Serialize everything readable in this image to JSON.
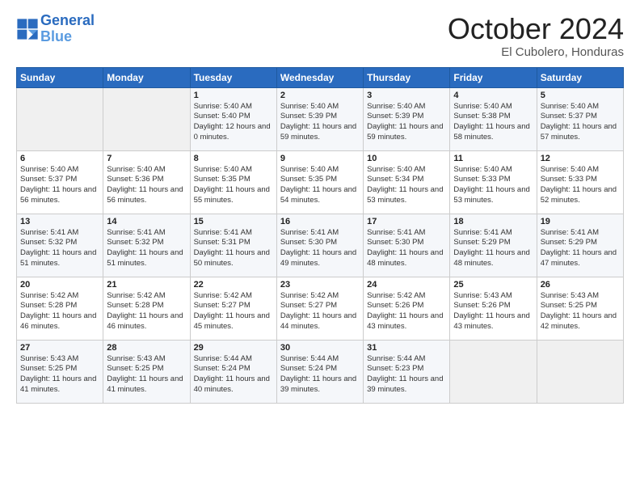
{
  "logo": {
    "line1": "General",
    "line2": "Blue"
  },
  "title": "October 2024",
  "location": "El Cubolero, Honduras",
  "days_header": [
    "Sunday",
    "Monday",
    "Tuesday",
    "Wednesday",
    "Thursday",
    "Friday",
    "Saturday"
  ],
  "weeks": [
    [
      {
        "day": "",
        "info": ""
      },
      {
        "day": "",
        "info": ""
      },
      {
        "day": "1",
        "sunrise": "5:40 AM",
        "sunset": "5:40 PM",
        "daylight": "12 hours and 0 minutes."
      },
      {
        "day": "2",
        "sunrise": "5:40 AM",
        "sunset": "5:39 PM",
        "daylight": "11 hours and 59 minutes."
      },
      {
        "day": "3",
        "sunrise": "5:40 AM",
        "sunset": "5:39 PM",
        "daylight": "11 hours and 59 minutes."
      },
      {
        "day": "4",
        "sunrise": "5:40 AM",
        "sunset": "5:38 PM",
        "daylight": "11 hours and 58 minutes."
      },
      {
        "day": "5",
        "sunrise": "5:40 AM",
        "sunset": "5:37 PM",
        "daylight": "11 hours and 57 minutes."
      }
    ],
    [
      {
        "day": "6",
        "sunrise": "5:40 AM",
        "sunset": "5:37 PM",
        "daylight": "11 hours and 56 minutes."
      },
      {
        "day": "7",
        "sunrise": "5:40 AM",
        "sunset": "5:36 PM",
        "daylight": "11 hours and 56 minutes."
      },
      {
        "day": "8",
        "sunrise": "5:40 AM",
        "sunset": "5:35 PM",
        "daylight": "11 hours and 55 minutes."
      },
      {
        "day": "9",
        "sunrise": "5:40 AM",
        "sunset": "5:35 PM",
        "daylight": "11 hours and 54 minutes."
      },
      {
        "day": "10",
        "sunrise": "5:40 AM",
        "sunset": "5:34 PM",
        "daylight": "11 hours and 53 minutes."
      },
      {
        "day": "11",
        "sunrise": "5:40 AM",
        "sunset": "5:33 PM",
        "daylight": "11 hours and 53 minutes."
      },
      {
        "day": "12",
        "sunrise": "5:40 AM",
        "sunset": "5:33 PM",
        "daylight": "11 hours and 52 minutes."
      }
    ],
    [
      {
        "day": "13",
        "sunrise": "5:41 AM",
        "sunset": "5:32 PM",
        "daylight": "11 hours and 51 minutes."
      },
      {
        "day": "14",
        "sunrise": "5:41 AM",
        "sunset": "5:32 PM",
        "daylight": "11 hours and 51 minutes."
      },
      {
        "day": "15",
        "sunrise": "5:41 AM",
        "sunset": "5:31 PM",
        "daylight": "11 hours and 50 minutes."
      },
      {
        "day": "16",
        "sunrise": "5:41 AM",
        "sunset": "5:30 PM",
        "daylight": "11 hours and 49 minutes."
      },
      {
        "day": "17",
        "sunrise": "5:41 AM",
        "sunset": "5:30 PM",
        "daylight": "11 hours and 48 minutes."
      },
      {
        "day": "18",
        "sunrise": "5:41 AM",
        "sunset": "5:29 PM",
        "daylight": "11 hours and 48 minutes."
      },
      {
        "day": "19",
        "sunrise": "5:41 AM",
        "sunset": "5:29 PM",
        "daylight": "11 hours and 47 minutes."
      }
    ],
    [
      {
        "day": "20",
        "sunrise": "5:42 AM",
        "sunset": "5:28 PM",
        "daylight": "11 hours and 46 minutes."
      },
      {
        "day": "21",
        "sunrise": "5:42 AM",
        "sunset": "5:28 PM",
        "daylight": "11 hours and 46 minutes."
      },
      {
        "day": "22",
        "sunrise": "5:42 AM",
        "sunset": "5:27 PM",
        "daylight": "11 hours and 45 minutes."
      },
      {
        "day": "23",
        "sunrise": "5:42 AM",
        "sunset": "5:27 PM",
        "daylight": "11 hours and 44 minutes."
      },
      {
        "day": "24",
        "sunrise": "5:42 AM",
        "sunset": "5:26 PM",
        "daylight": "11 hours and 43 minutes."
      },
      {
        "day": "25",
        "sunrise": "5:43 AM",
        "sunset": "5:26 PM",
        "daylight": "11 hours and 43 minutes."
      },
      {
        "day": "26",
        "sunrise": "5:43 AM",
        "sunset": "5:25 PM",
        "daylight": "11 hours and 42 minutes."
      }
    ],
    [
      {
        "day": "27",
        "sunrise": "5:43 AM",
        "sunset": "5:25 PM",
        "daylight": "11 hours and 41 minutes."
      },
      {
        "day": "28",
        "sunrise": "5:43 AM",
        "sunset": "5:25 PM",
        "daylight": "11 hours and 41 minutes."
      },
      {
        "day": "29",
        "sunrise": "5:44 AM",
        "sunset": "5:24 PM",
        "daylight": "11 hours and 40 minutes."
      },
      {
        "day": "30",
        "sunrise": "5:44 AM",
        "sunset": "5:24 PM",
        "daylight": "11 hours and 39 minutes."
      },
      {
        "day": "31",
        "sunrise": "5:44 AM",
        "sunset": "5:23 PM",
        "daylight": "11 hours and 39 minutes."
      },
      {
        "day": "",
        "info": ""
      },
      {
        "day": "",
        "info": ""
      }
    ]
  ]
}
